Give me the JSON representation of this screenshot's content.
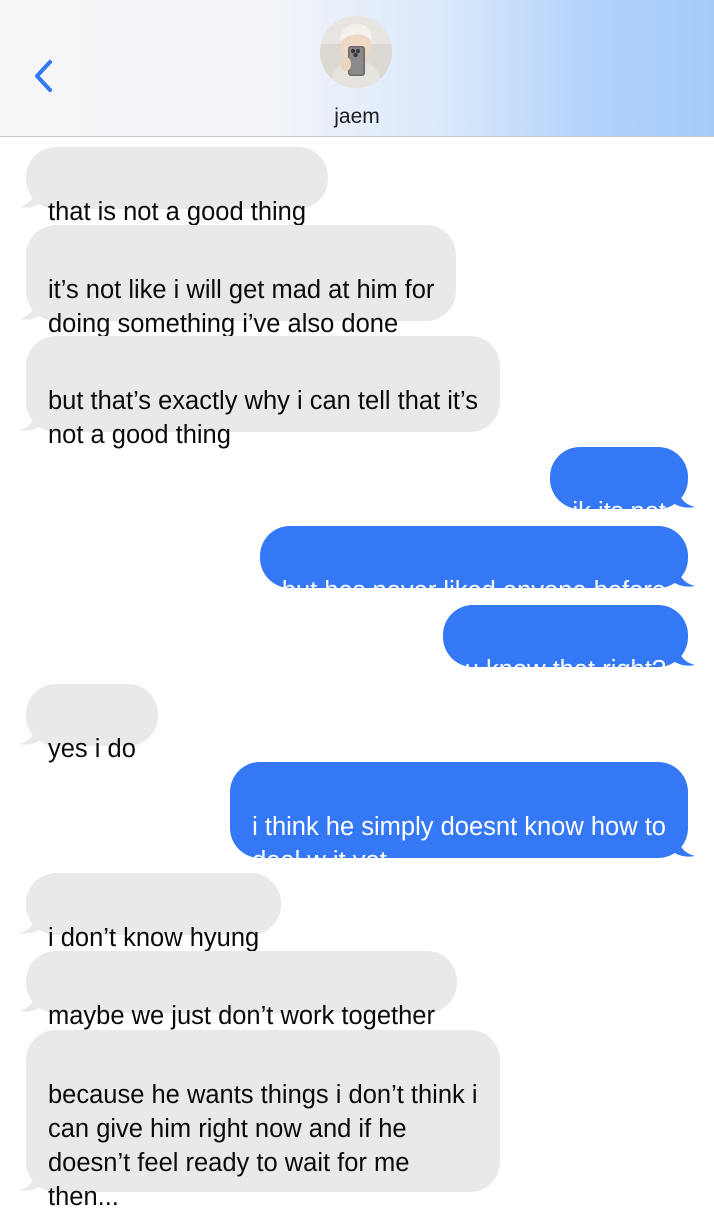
{
  "header": {
    "back_icon": "chevron-left-icon",
    "contact_name": "jaem",
    "avatar_icon": "contact-photo"
  },
  "colors": {
    "sent_bubble": "#3478f6",
    "received_bubble": "#e9e9eb",
    "accent": "#3478f6"
  },
  "messages": [
    {
      "direction": "received",
      "text": "that is not a good thing"
    },
    {
      "direction": "received",
      "text": "it’s not like i will get mad at him for\ndoing something i’ve also done"
    },
    {
      "direction": "received",
      "text": "but that’s exactly why i can tell that it’s\nnot a good thing"
    },
    {
      "direction": "sent",
      "text": "ik its not"
    },
    {
      "direction": "sent",
      "text": "but hes never liked anyone before"
    },
    {
      "direction": "sent",
      "text": "u know that right?"
    },
    {
      "direction": "received",
      "text": "yes i do"
    },
    {
      "direction": "sent",
      "text": "i think he simply doesnt know how to\ndeal w it yet..."
    },
    {
      "direction": "received",
      "text": "i don’t know hyung"
    },
    {
      "direction": "received",
      "text": "maybe we just don’t work together"
    },
    {
      "direction": "received",
      "text": "because he wants things i don’t think i\ncan give him right now and if he\ndoesn’t feel ready to wait for me\nthen..."
    }
  ]
}
